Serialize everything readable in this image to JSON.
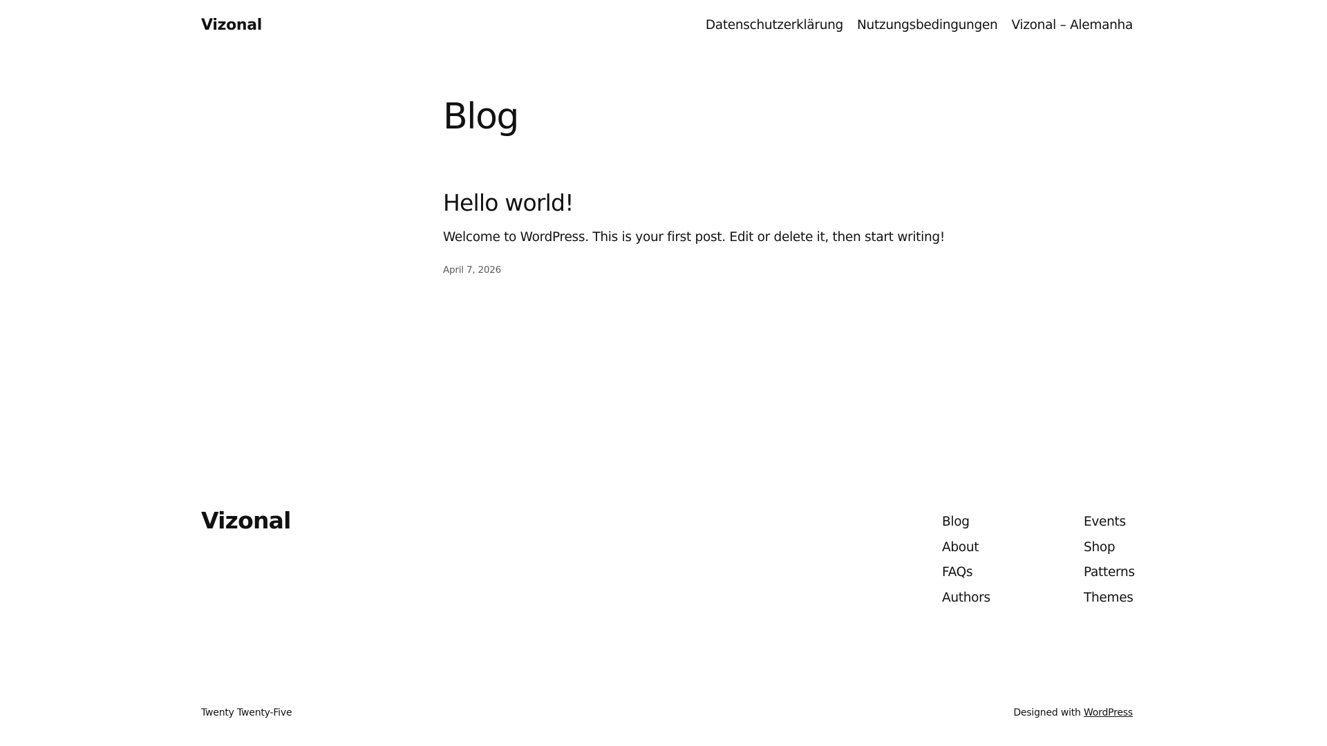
{
  "header": {
    "site_title": "Vizonal",
    "nav": [
      {
        "label": "Datenschutzerklärung"
      },
      {
        "label": "Nutzungsbedingungen"
      },
      {
        "label": "Vizonal – Alemanha"
      }
    ]
  },
  "main": {
    "page_title": "Blog",
    "posts": [
      {
        "title": "Hello world!",
        "excerpt": "Welcome to WordPress. This is your first post. Edit or delete it, then start writing!",
        "date": "April 7, 2026"
      }
    ]
  },
  "footer": {
    "site_title": "Vizonal",
    "nav_col1": [
      {
        "label": "Blog"
      },
      {
        "label": "About"
      },
      {
        "label": "FAQs"
      },
      {
        "label": "Authors"
      }
    ],
    "nav_col2": [
      {
        "label": "Events"
      },
      {
        "label": "Shop"
      },
      {
        "label": "Patterns"
      },
      {
        "label": "Themes"
      }
    ],
    "theme_name": "Twenty Twenty-Five",
    "credit_prefix": "Designed with ",
    "credit_link": "WordPress"
  }
}
